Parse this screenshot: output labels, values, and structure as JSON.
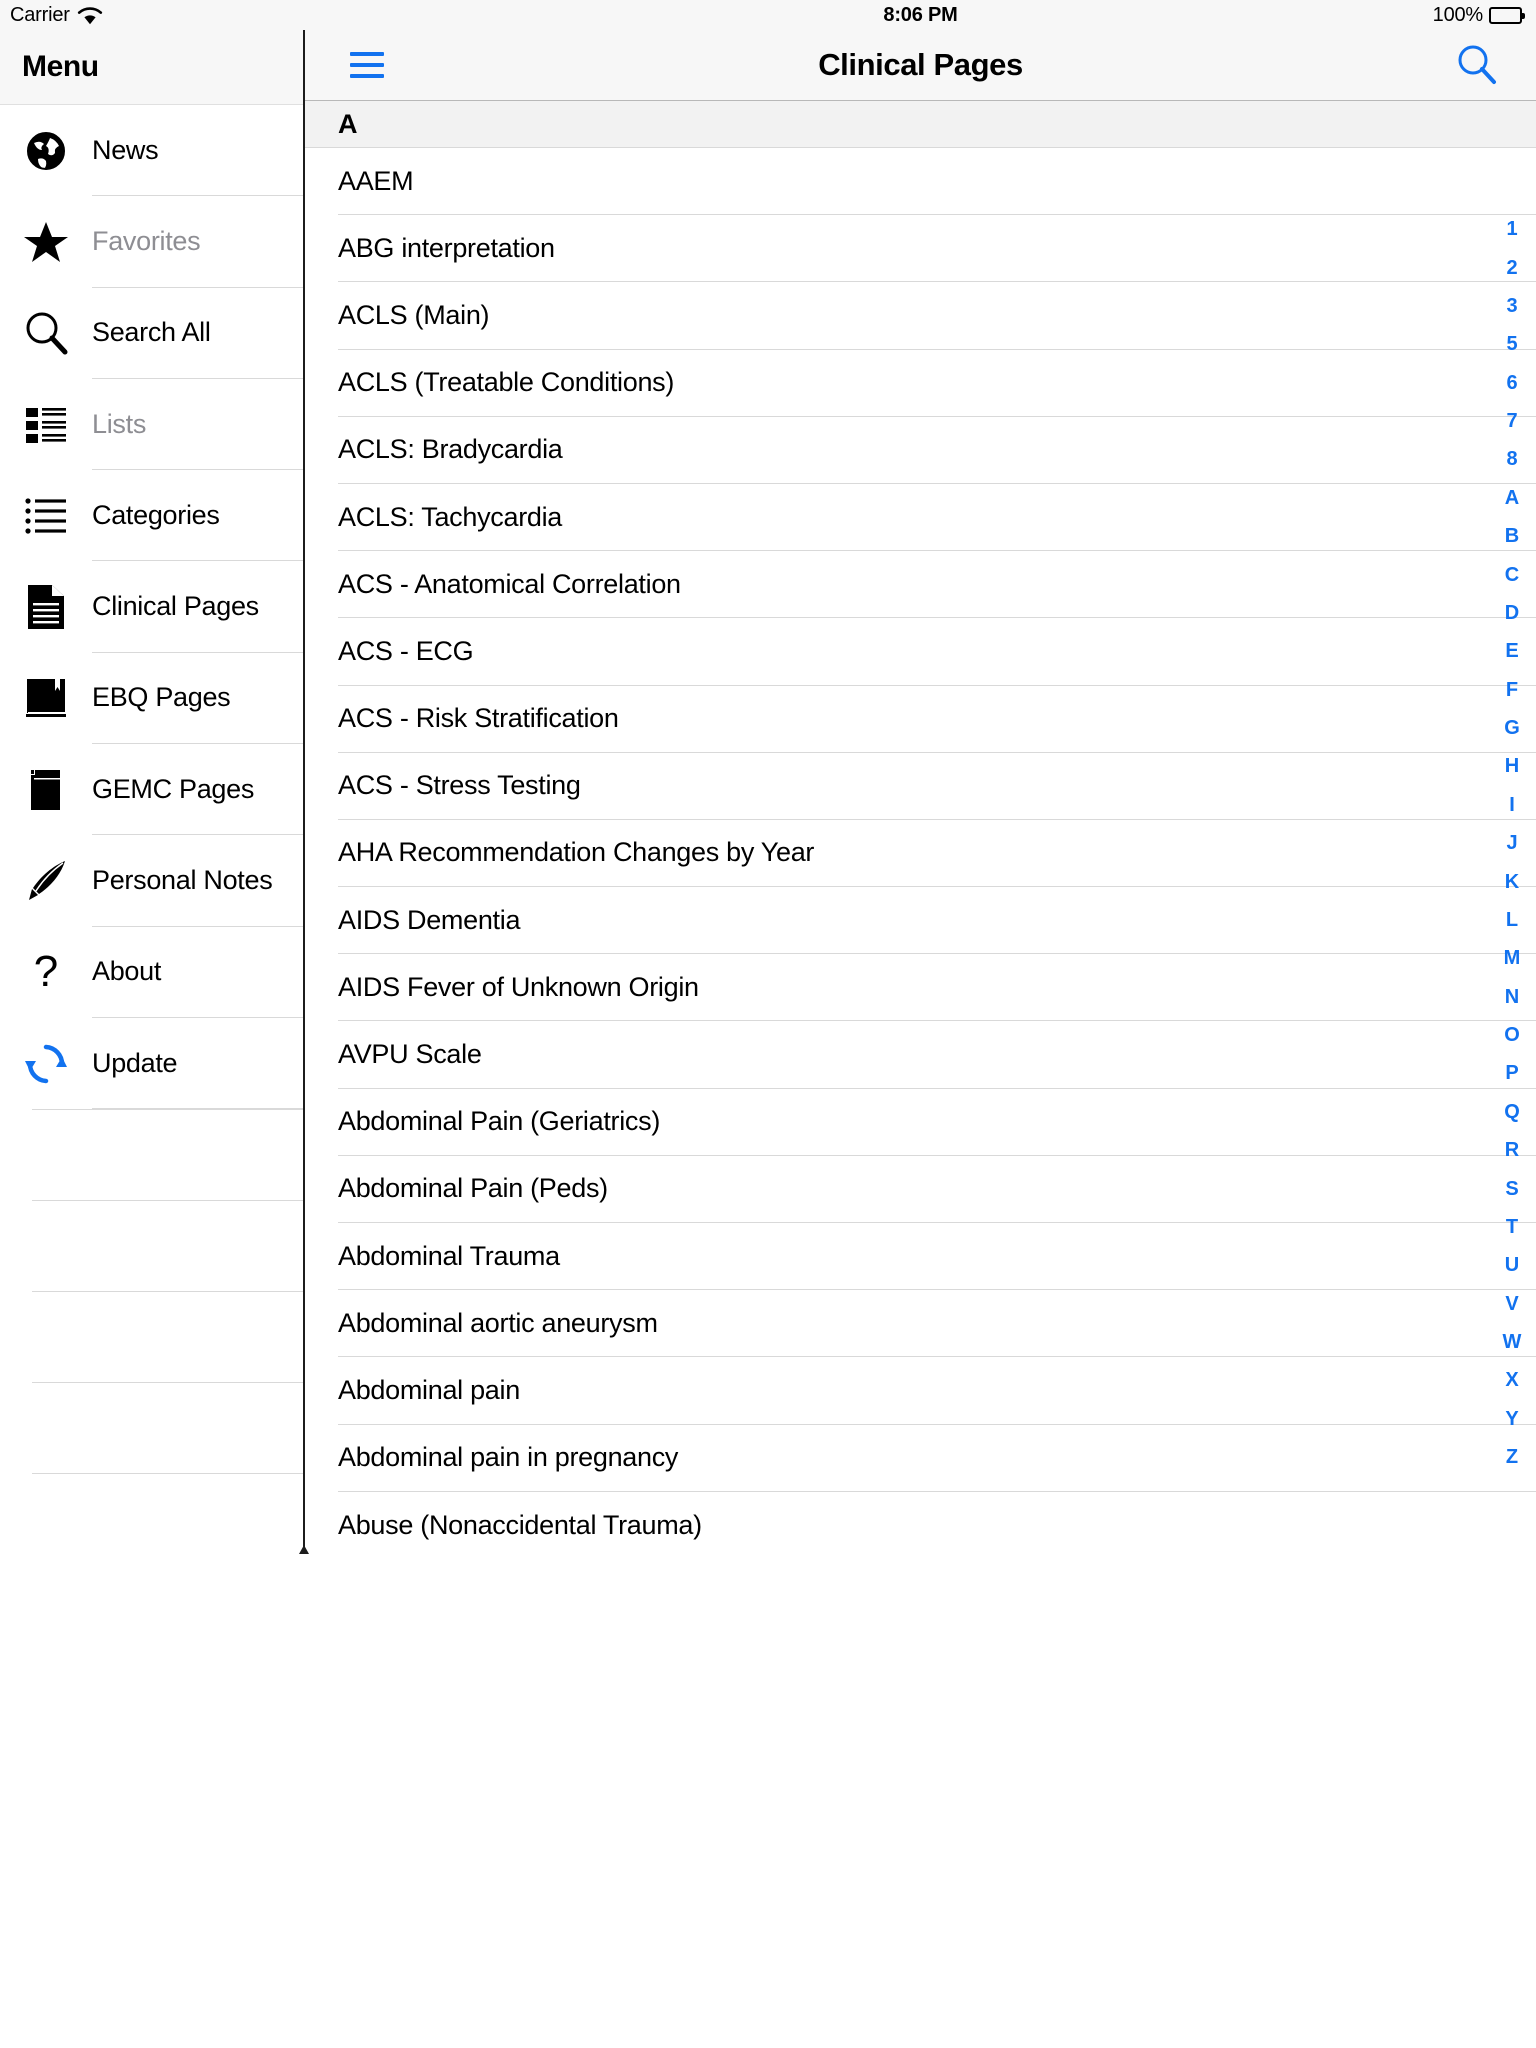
{
  "status_bar": {
    "carrier": "Carrier",
    "wifi_icon": "wifi-icon",
    "time": "8:06 PM",
    "battery_percent": "100%",
    "battery_icon": "battery-full-icon"
  },
  "sidebar": {
    "title": "Menu",
    "items": [
      {
        "label": "News",
        "icon": "globe-icon",
        "disabled": false
      },
      {
        "label": "Favorites",
        "icon": "star-icon",
        "disabled": true
      },
      {
        "label": "Search All",
        "icon": "magnifier-icon",
        "disabled": false
      },
      {
        "label": "Lists",
        "icon": "bullet-list-icon",
        "disabled": true
      },
      {
        "label": "Categories",
        "icon": "list-lines-icon",
        "disabled": false
      },
      {
        "label": "Clinical Pages",
        "icon": "document-icon",
        "disabled": false
      },
      {
        "label": "EBQ Pages",
        "icon": "book-icon",
        "disabled": false
      },
      {
        "label": "GEMC Pages",
        "icon": "notebook-icon",
        "disabled": false
      },
      {
        "label": "Personal Notes",
        "icon": "quill-pen-icon",
        "disabled": false
      },
      {
        "label": "About",
        "icon": "question-mark-icon",
        "disabled": false
      },
      {
        "label": "Update",
        "icon": "refresh-icon",
        "disabled": false
      }
    ],
    "empty_row_count": 4
  },
  "navbar": {
    "menu_icon": "hamburger-menu-icon",
    "title": "Clinical Pages",
    "search_icon": "search-icon"
  },
  "list": {
    "section_header": "A",
    "rows": [
      "AAEM",
      "ABG interpretation",
      "ACLS (Main)",
      "ACLS (Treatable Conditions)",
      "ACLS: Bradycardia",
      "ACLS: Tachycardia",
      "ACS - Anatomical Correlation",
      "ACS - ECG",
      "ACS - Risk Stratification",
      "ACS - Stress Testing",
      "AHA Recommendation Changes by Year",
      "AIDS Dementia",
      "AIDS Fever of Unknown Origin",
      "AVPU Scale",
      "Abdominal Pain (Geriatrics)",
      "Abdominal Pain (Peds)",
      "Abdominal Trauma",
      "Abdominal aortic aneurysm",
      "Abdominal pain",
      "Abdominal pain in pregnancy",
      "Abuse (Nonaccidental Trauma)"
    ]
  },
  "alpha_index": [
    "1",
    "2",
    "3",
    "5",
    "6",
    "7",
    "8",
    "A",
    "B",
    "C",
    "D",
    "E",
    "F",
    "G",
    "H",
    "I",
    "J",
    "K",
    "L",
    "M",
    "N",
    "O",
    "P",
    "Q",
    "R",
    "S",
    "T",
    "U",
    "V",
    "W",
    "X",
    "Y",
    "Z"
  ],
  "colors": {
    "accent_blue": "#1272ef",
    "disabled_grey": "#8e8e93",
    "bar_background": "#f7f7f7",
    "section_background": "#f2f2f2",
    "separator": "#d9d9d9"
  }
}
